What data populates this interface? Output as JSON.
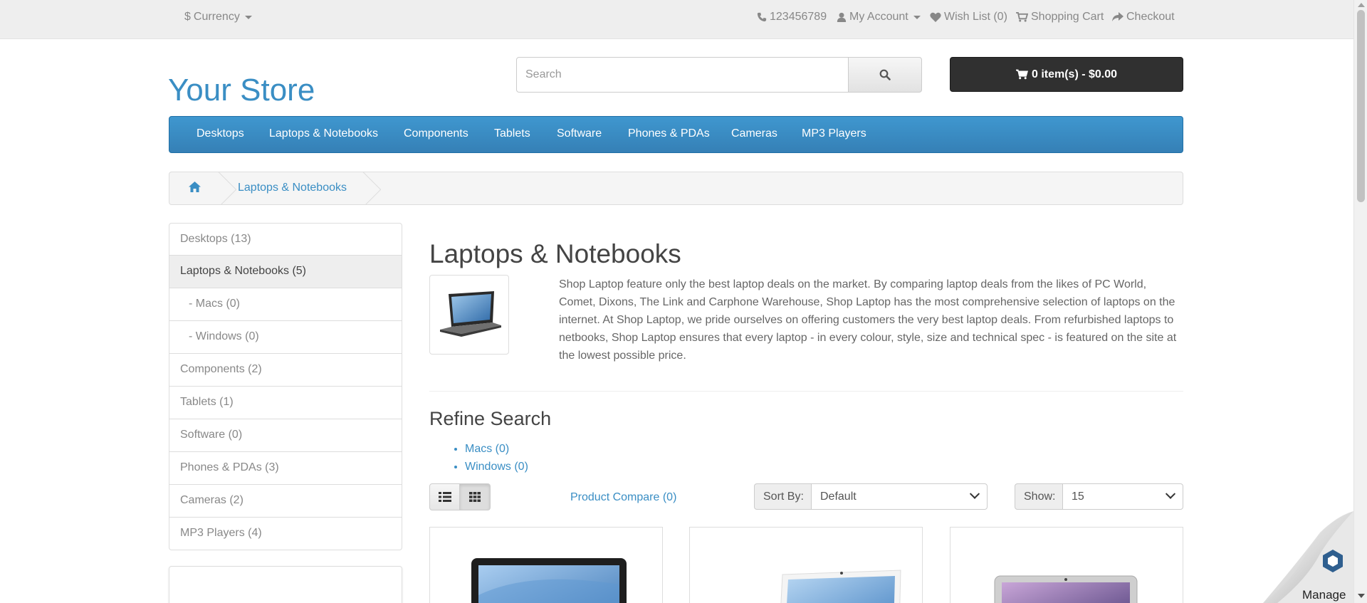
{
  "topbar": {
    "currency_label": "Currency",
    "currency_symbol": "$",
    "phone": "123456789",
    "my_account": "My Account",
    "wish_list": "Wish List (0)",
    "shopping_cart": "Shopping Cart",
    "checkout": "Checkout"
  },
  "logo": "Your Store",
  "search": {
    "placeholder": "Search"
  },
  "cart": {
    "label": "0 item(s) - $0.00"
  },
  "menu": [
    "Desktops",
    "Laptops & Notebooks",
    "Components",
    "Tablets",
    "Software",
    "Phones & PDAs",
    "Cameras",
    "MP3 Players"
  ],
  "breadcrumb": {
    "current": "Laptops & Notebooks"
  },
  "sidebar": [
    "Desktops (13)",
    "Laptops & Notebooks (5)",
    "- Macs (0)",
    "- Windows (0)",
    "Components (2)",
    "Tablets (1)",
    "Software (0)",
    "Phones & PDAs (3)",
    "Cameras (2)",
    "MP3 Players (4)"
  ],
  "category": {
    "title": "Laptops & Notebooks",
    "description": "Shop Laptop feature only the best laptop deals on the market. By comparing laptop deals from the likes of PC World, Comet, Dixons, The Link and Carphone Warehouse, Shop Laptop has the most comprehensive selection of laptops on the internet. At Shop Laptop, we pride ourselves on offering customers the very best laptop deals. From refurbished laptops to netbooks, Shop Laptop ensures that every laptop - in every colour, style, size and technical spec - is featured on the site at the lowest possible price."
  },
  "refine": {
    "title": "Refine Search",
    "links": [
      "Macs (0)",
      "Windows (0)"
    ]
  },
  "toolbar": {
    "product_compare": "Product Compare (0)",
    "sort_label": "Sort By:",
    "sort_value": "Default",
    "show_label": "Show:",
    "show_value": "15"
  },
  "widget": {
    "manage_label": "Manage"
  },
  "colors": {
    "accent": "#3a8ec4",
    "menu": "#3a8ec4",
    "cart": "#303030",
    "topbar": "#eeeeee"
  }
}
